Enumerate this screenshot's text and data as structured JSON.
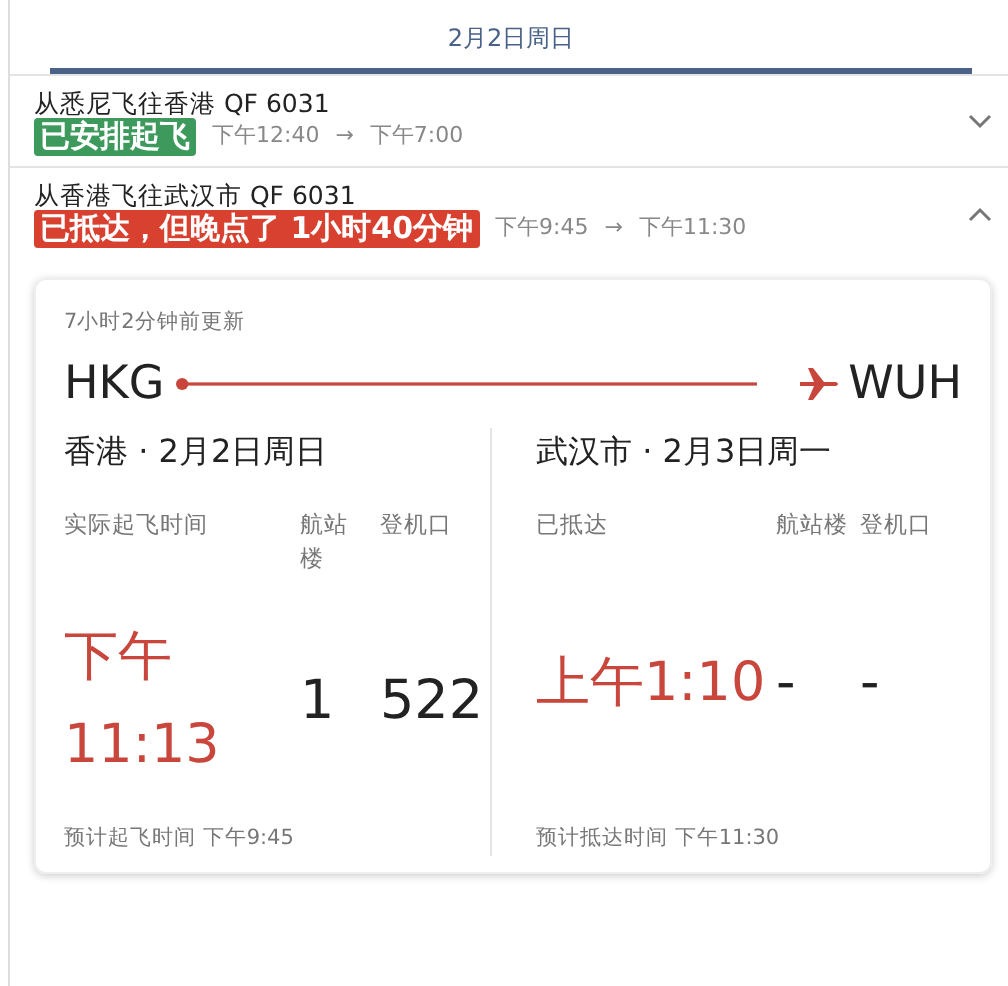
{
  "date_tab": {
    "label": "2月2日周日",
    "selected": true
  },
  "flights": [
    {
      "route": "从悉尼飞往香港 QF 6031",
      "status": "已安排起飞",
      "color": "#3d9a5c",
      "departure": "下午12:40",
      "arrow": "→",
      "arrival": "下午7:00",
      "expanded": false
    },
    {
      "route": "从香港飞往武汉市 QF 6031",
      "status": "已抵达，但晚点了 1小时40分钟",
      "color": "#d8412f",
      "departure": "下午9:45",
      "arrow": "→",
      "arrival": "下午11:30",
      "expanded": true
    }
  ],
  "detail": {
    "updated": "7小时2分钟前更新",
    "origin_code": "HKG",
    "destination_code": "WUH",
    "ends": [
      {
        "place_date": "香港 · 2月2日周日",
        "time_label": "实际起飞时间",
        "terminal_label": "航站楼",
        "gate_label": "登机口",
        "time": "下午11:13",
        "terminal": "1",
        "gate": "522",
        "scheduled": "预计起飞时间 下午9:45"
      },
      {
        "place_date": "武汉市 · 2月3日周一",
        "time_label": "已抵达",
        "terminal_label": "航站楼",
        "gate_label": "登机口",
        "time": "上午1:10",
        "terminal": "-",
        "gate": "-",
        "scheduled": "预计抵达时间 下午11:30"
      }
    ]
  }
}
